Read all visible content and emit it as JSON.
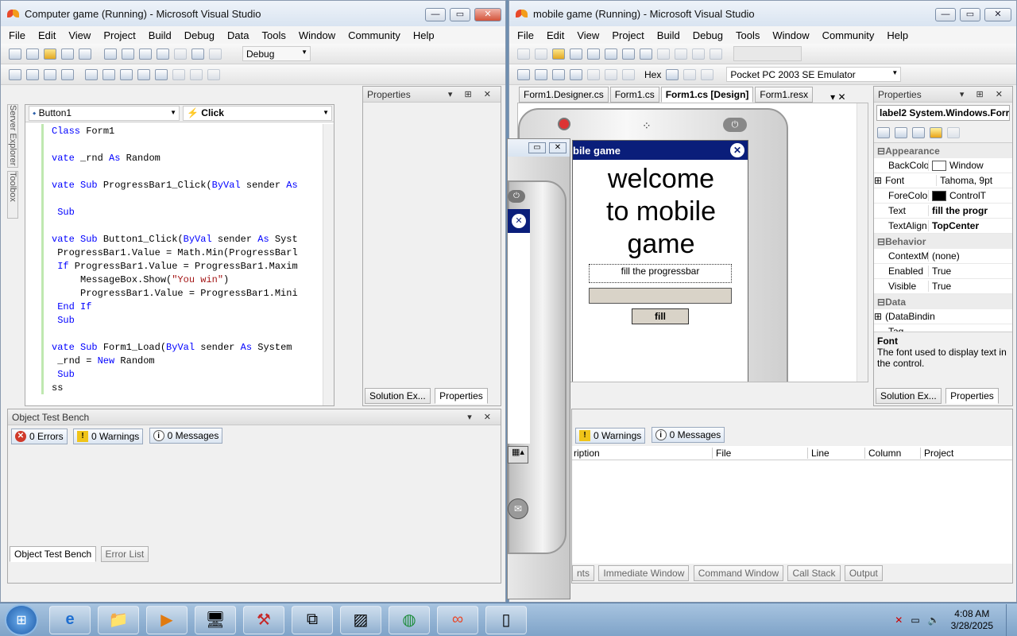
{
  "left_window": {
    "title": "Computer game (Running) - Microsoft Visual Studio",
    "menu": [
      "File",
      "Edit",
      "View",
      "Project",
      "Build",
      "Debug",
      "Data",
      "Tools",
      "Window",
      "Community",
      "Help"
    ],
    "config": "Debug",
    "side_tabs": [
      "Server Explorer",
      "Toolbox"
    ],
    "object_combo": "Button1",
    "event_combo": "Click",
    "code_lines": [
      {
        "t": "Class Form1",
        "kind": "kw-first"
      },
      {
        "t": "",
        "kind": "plain"
      },
      {
        "t": "vate _rnd As Random",
        "kind": "decl"
      },
      {
        "t": "",
        "kind": "plain"
      },
      {
        "t": "vate Sub ProgressBar1_Click(ByVal sender As",
        "kind": "sub"
      },
      {
        "t": "",
        "kind": "plain"
      },
      {
        "t": " Sub",
        "kind": "end"
      },
      {
        "t": "",
        "kind": "plain"
      },
      {
        "t": "vate Sub Button1_Click(ByVal sender As Syst",
        "kind": "sub"
      },
      {
        "t": " ProgressBar1.Value = Math.Min(ProgressBarl",
        "kind": "plain"
      },
      {
        "t": " If ProgressBar1.Value = ProgressBar1.Maxim",
        "kind": "if"
      },
      {
        "t": "     MessageBox.Show(\"You win\")",
        "kind": "msg"
      },
      {
        "t": "     ProgressBar1.Value = ProgressBar1.Mini",
        "kind": "plain"
      },
      {
        "t": " End If",
        "kind": "endif"
      },
      {
        "t": " Sub",
        "kind": "end"
      },
      {
        "t": "",
        "kind": "plain"
      },
      {
        "t": "vate Sub Form1_Load(ByVal sender As System",
        "kind": "sub"
      },
      {
        "t": " _rnd = New Random",
        "kind": "new"
      },
      {
        "t": " Sub",
        "kind": "end"
      },
      {
        "t": "ss",
        "kind": "end"
      }
    ],
    "properties_title": "Properties",
    "solution_tab": "Solution Ex...",
    "properties_tab": "Properties",
    "bench_title": "Object Test Bench",
    "errors": "0 Errors",
    "warnings": "0 Warnings",
    "messages": "0 Messages",
    "bottom_tabs": [
      "Object Test Bench",
      "Error List"
    ]
  },
  "right_window": {
    "title": "mobile game (Running) - Microsoft Visual Studio",
    "menu": [
      "File",
      "Edit",
      "View",
      "Project",
      "Build",
      "Debug",
      "Tools",
      "Window",
      "Community",
      "Help"
    ],
    "hex_label": "Hex",
    "emulator": "Pocket PC 2003 SE Emulator",
    "doc_tabs": [
      "Form1.Designer.cs",
      "Form1.cs",
      "Form1.cs [Design]",
      "Form1.resx"
    ],
    "form": {
      "title": "bile game",
      "welcome": "welcome to mobile game",
      "label": "fill the progressbar",
      "button": "fill"
    },
    "properties": {
      "title": "Properties",
      "selected": "label2  System.Windows.Forr",
      "sections": [
        {
          "name": "Appearance",
          "rows": [
            {
              "n": "BackColor",
              "v": "Window",
              "swatch": "#ffffff"
            },
            {
              "n": "Font",
              "v": "Tahoma, 9pt",
              "plus": true
            },
            {
              "n": "ForeColor",
              "v": "ControlT",
              "swatch": "#000000"
            },
            {
              "n": "Text",
              "v": "fill the progr",
              "bold": true
            },
            {
              "n": "TextAlign",
              "v": "TopCenter",
              "bold": true
            }
          ]
        },
        {
          "name": "Behavior",
          "rows": [
            {
              "n": "ContextMer",
              "v": "(none)"
            },
            {
              "n": "Enabled",
              "v": "True"
            },
            {
              "n": "Visible",
              "v": "True"
            }
          ]
        },
        {
          "name": "Data",
          "rows": [
            {
              "n": "(DataBindin",
              "v": "",
              "plus": true
            },
            {
              "n": "Tag",
              "v": ""
            }
          ]
        }
      ],
      "desc_title": "Font",
      "desc_text": "The font used to display text in the control.",
      "solution_tab": "Solution Ex...",
      "properties_tab": "Properties"
    },
    "warnings": "0 Warnings",
    "messages": "0 Messages",
    "columns": [
      "ription",
      "File",
      "Line",
      "Column",
      "Project"
    ],
    "bottom_tabs": [
      "nts",
      "Immediate Window",
      "Command Window",
      "Call Stack",
      "Output"
    ]
  },
  "taskbar": {
    "time": "4:08 AM",
    "date": "3/28/2025"
  }
}
